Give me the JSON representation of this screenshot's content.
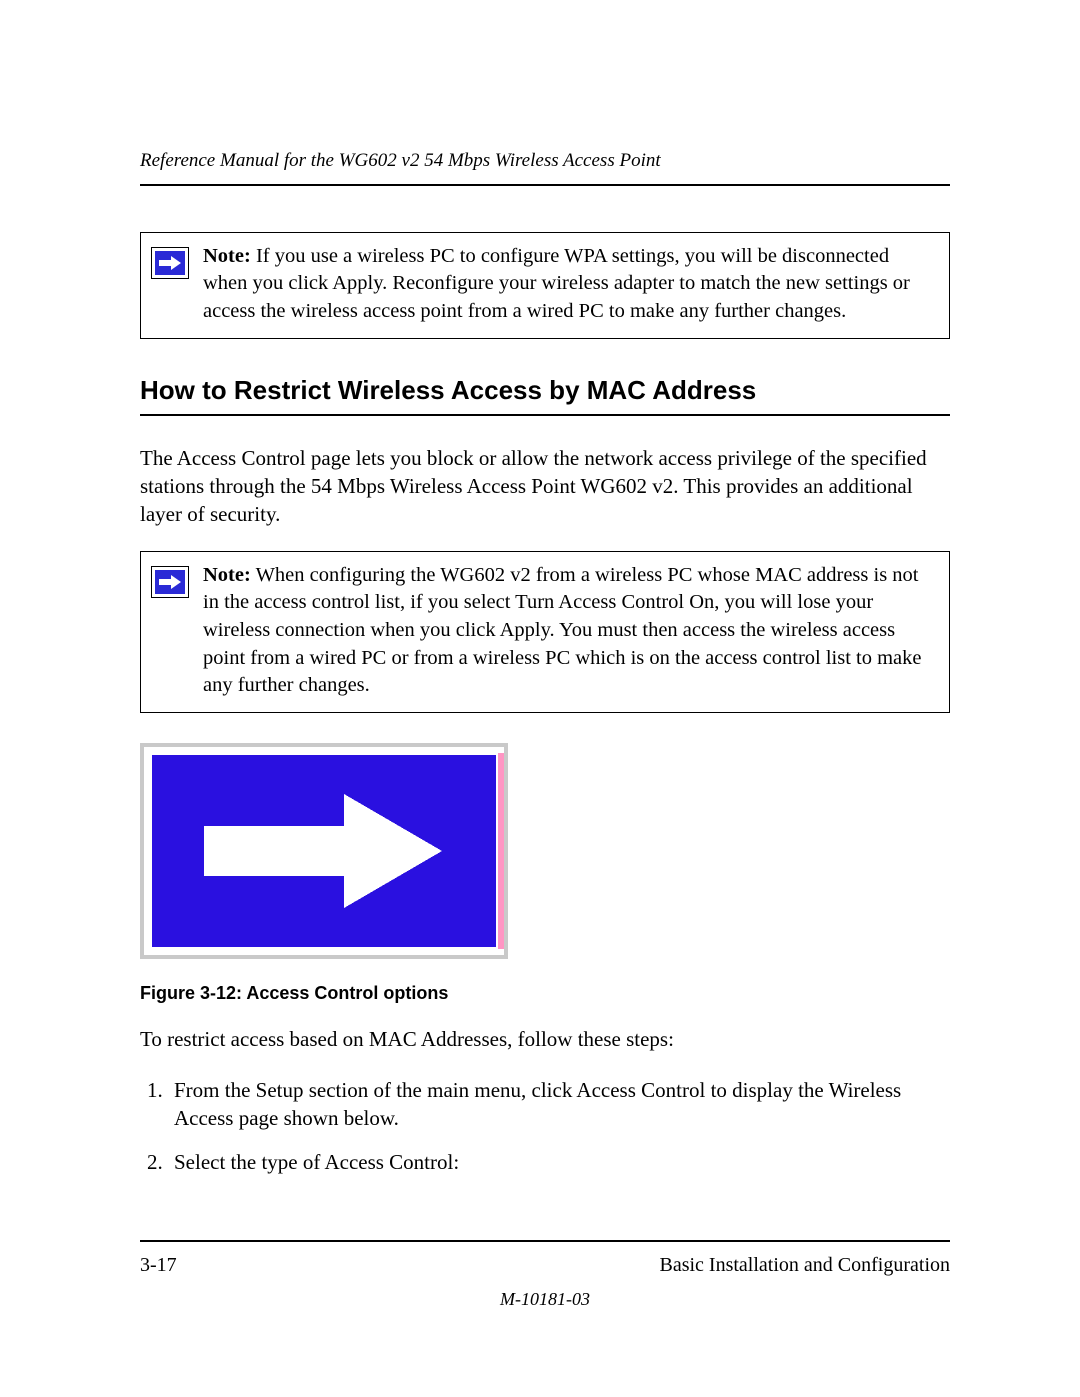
{
  "header": {
    "running_title": "Reference Manual for the WG602 v2 54 Mbps Wireless Access Point"
  },
  "note1": {
    "label": "Note:",
    "text": " If you use a wireless PC to configure WPA settings, you will be disconnected when you click Apply. Reconfigure your wireless adapter to match the new settings or access the wireless access point from a wired PC to make any further changes."
  },
  "section": {
    "heading": "How to Restrict Wireless Access by MAC Address",
    "intro": "The Access Control page lets you block or allow the network access privilege of the specified stations through the 54 Mbps Wireless Access Point WG602 v2. This provides an additional layer of security."
  },
  "note2": {
    "label": "Note:",
    "text": " When configuring the WG602 v2 from a wireless PC whose MAC address is not in the access control list, if you select Turn Access Control On, you will lose your wireless connection when you click Apply. You must then access the wireless access point from a wired PC or from a wireless PC which is on the access control list to make any further changes."
  },
  "figure": {
    "caption": "Figure 3-12: Access Control options"
  },
  "steps": {
    "intro": "To restrict access based on MAC Addresses, follow these steps:",
    "items": [
      "From the Setup section of the main menu, click Access Control to display the Wireless Access page shown below.",
      "Select the type of Access Control:"
    ]
  },
  "footer": {
    "page": "3-17",
    "chapter": "Basic Installation and Configuration",
    "doc_id": "M-10181-03"
  }
}
